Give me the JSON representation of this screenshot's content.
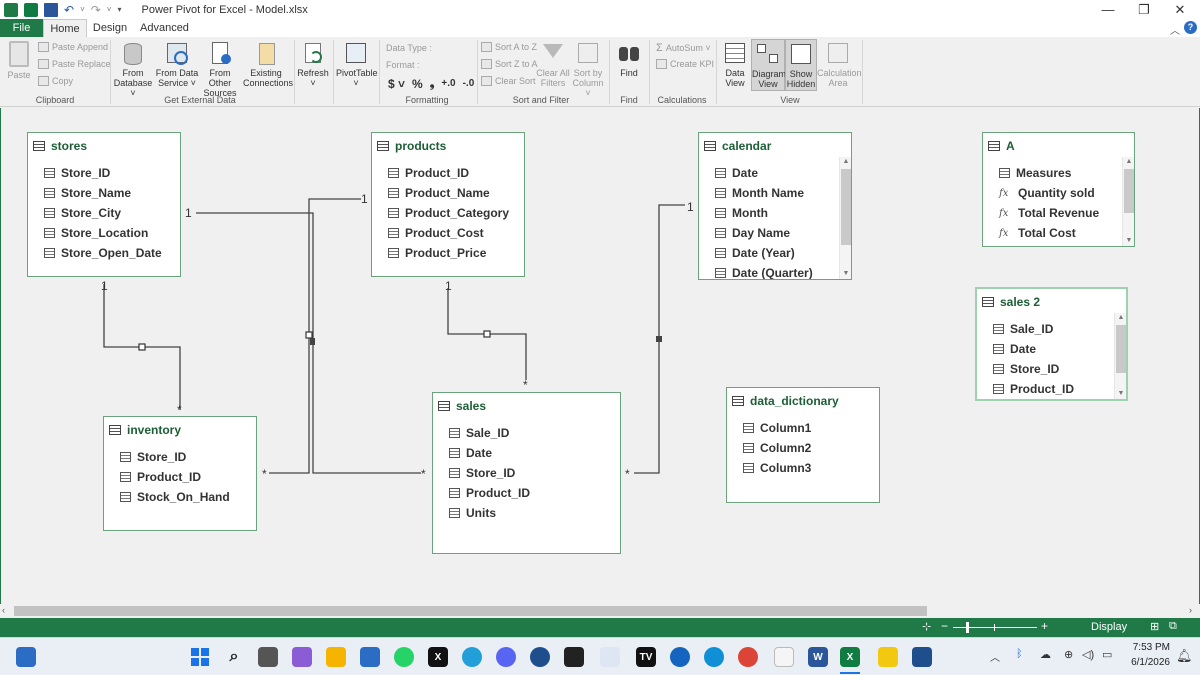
{
  "window": {
    "title": "Power Pivot for Excel - Model.xlsx"
  },
  "tabs": {
    "file": "File",
    "home": "Home",
    "design": "Design",
    "advanced": "Advanced"
  },
  "ribbon": {
    "clipboard": {
      "paste": "Paste",
      "paste_append": "Paste Append",
      "paste_replace": "Paste Replace",
      "copy": "Copy",
      "label": "Clipboard"
    },
    "external": {
      "from_database": [
        "From",
        "Database ˅"
      ],
      "from_data_service": [
        "From Data",
        "Service ˅"
      ],
      "from_other_sources": [
        "From Other",
        "Sources"
      ],
      "existing_connections": [
        "Existing",
        "Connections"
      ],
      "label": "Get External Data"
    },
    "refresh": [
      "Refresh",
      "˅"
    ],
    "pivottable": [
      "PivotTable",
      "˅"
    ],
    "formatting": {
      "data_type": "Data Type :",
      "format": "Format :",
      "currency": "$ ˅",
      "percent": "%",
      "comma": "❟",
      "inc_decimal": "+.0",
      "dec_decimal": "-.0",
      "label": "Formatting"
    },
    "sort": {
      "sort_az": "Sort A to Z",
      "sort_za": "Sort Z to A",
      "clear_sort": "Clear Sort",
      "clear_all_filters": [
        "Clear All",
        "Filters"
      ],
      "sort_by_column": [
        "Sort by",
        "Column ˅"
      ],
      "label": "Sort and Filter"
    },
    "find": {
      "button": "Find",
      "label": "Find"
    },
    "calculations": {
      "autosum": "AutoSum ˅",
      "create_kpi": "Create KPI",
      "label": "Calculations"
    },
    "view": {
      "data_view": [
        "Data",
        "View"
      ],
      "diagram_view": [
        "Diagram",
        "View"
      ],
      "show_hidden": [
        "Show",
        "Hidden"
      ],
      "calculation_area": [
        "Calculation",
        "Area"
      ],
      "label": "View"
    }
  },
  "tables": {
    "stores": {
      "name": "stores",
      "columns": [
        "Store_ID",
        "Store_Name",
        "Store_City",
        "Store_Location",
        "Store_Open_Date"
      ]
    },
    "products": {
      "name": "products",
      "columns": [
        "Product_ID",
        "Product_Name",
        "Product_Category",
        "Product_Cost",
        "Product_Price"
      ]
    },
    "calendar": {
      "name": "calendar",
      "columns": [
        "Date",
        "Month Name",
        "Month",
        "Day Name",
        "Date (Year)",
        "Date (Quarter)"
      ]
    },
    "measures": {
      "name": "A",
      "rows": [
        "Measures",
        "Quantity sold",
        "Total Revenue",
        "Total Cost"
      ]
    },
    "sales2": {
      "name": "sales  2",
      "columns": [
        "Sale_ID",
        "Date",
        "Store_ID",
        "Product_ID"
      ]
    },
    "inventory": {
      "name": "inventory",
      "columns": [
        "Store_ID",
        "Product_ID",
        "Stock_On_Hand"
      ]
    },
    "sales": {
      "name": "sales",
      "columns": [
        "Sale_ID",
        "Date",
        "Store_ID",
        "Product_ID",
        "Units"
      ]
    },
    "data_dictionary": {
      "name": "data_dictionary",
      "columns": [
        "Column1",
        "Column2",
        "Column3"
      ]
    }
  },
  "relationships": {
    "one": "1",
    "many": "*"
  },
  "statusbar": {
    "display": "Display"
  },
  "taskbar": {
    "time": "7:53 PM",
    "date": "6/1/2026"
  },
  "colors": {
    "accent": "#1f7a47",
    "table_border": "#6aa37e",
    "table_title": "#1d5e35"
  }
}
